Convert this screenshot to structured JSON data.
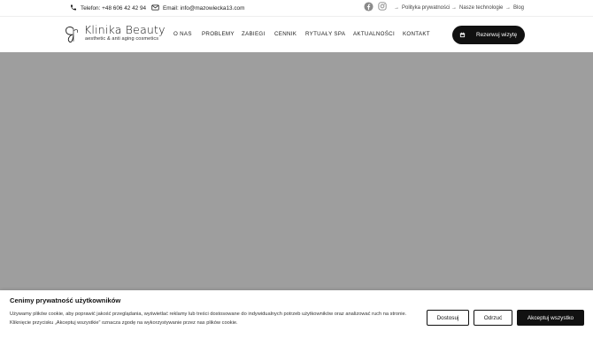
{
  "topbar": {
    "phone": "Telefon: +48 606 42 42 94",
    "email": "Email: info@mazowiecka13.com",
    "links": [
      "Polityka prywatności",
      "Nasze technologie",
      "Blog"
    ]
  },
  "header": {
    "logo_name": "Klinika Beauty",
    "logo_tagline": "aesthetic & anti aging cosmetics",
    "nav": [
      "O NAS",
      "PROBLEMY",
      "ZABIEGI",
      "CENNIK",
      "RYTUAŁY SPA",
      "AKTUALNOŚCI",
      "KONTAKT"
    ],
    "cta_label": "Rezerwuj wizytę"
  },
  "cookie": {
    "title": "Cenimy prywatność użytkowników",
    "text": "Używamy plików cookie, aby poprawić jakość przeglądania, wyświetlać reklamy lub treści dostosowane do indywidualnych potrzeb użytkowników oraz analizować ruch na stronie. Kliknięcie przycisku „Akceptuj wszystkie” oznacza zgodę na wykorzystywanie przez nas plików cookie.",
    "buttons": [
      "Dostosuj",
      "Odrzuć",
      "Akceptuj wszystko"
    ]
  },
  "colors": {
    "accent": "#111111",
    "hero_background": "#9e9e9e",
    "text": "#222222"
  },
  "icons": [
    "phone-icon",
    "mail-icon",
    "facebook-icon",
    "instagram-icon",
    "calendar-icon",
    "butterfly-logo-icon"
  ]
}
